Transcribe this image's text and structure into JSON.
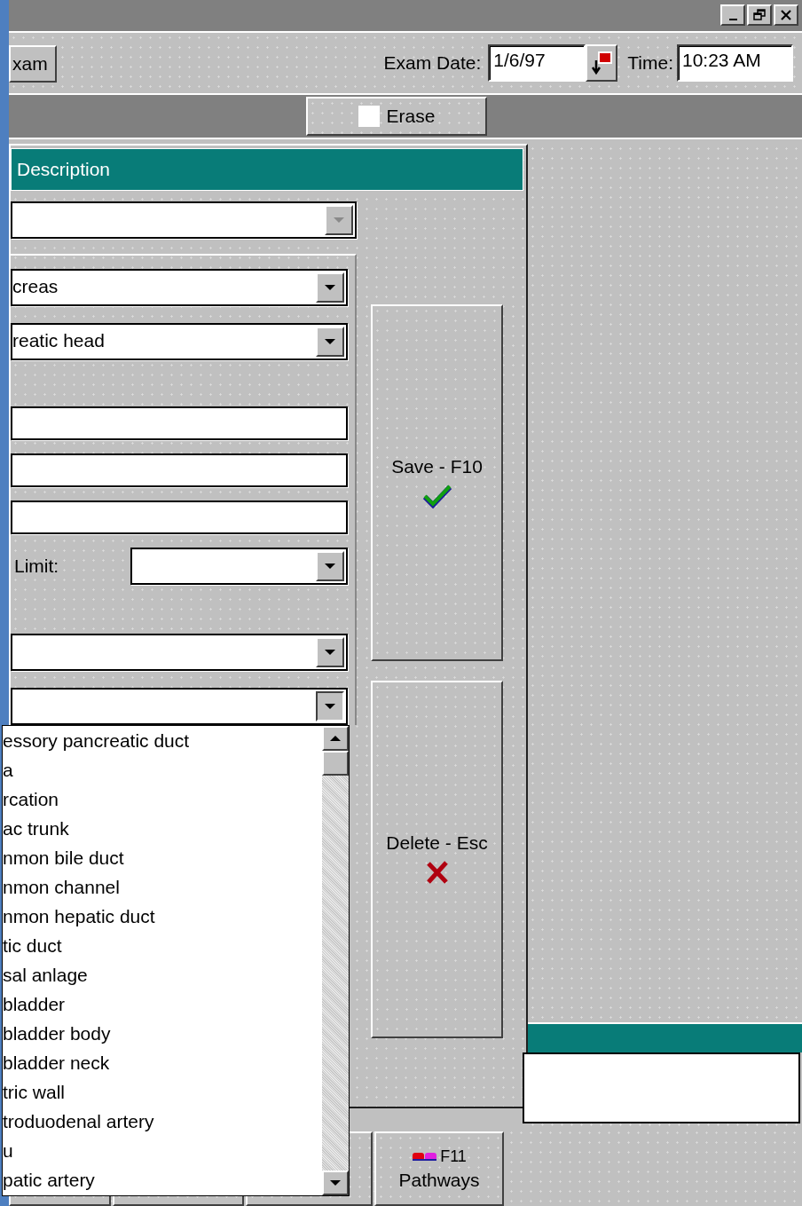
{
  "toolbar": {
    "exam_button": "xam",
    "exam_date_label": "Exam Date:",
    "exam_date": "1/6/97",
    "time_label": "Time:",
    "time": "10:23 AM"
  },
  "erase_button": {
    "label": "Erase"
  },
  "form": {
    "title": "Description",
    "top_dropdown": {
      "disabled": true
    },
    "sections": [
      [
        {
          "kind": "dropdown",
          "value": "creas",
          "disabled": false,
          "expanded": false
        },
        {
          "kind": "dropdown",
          "value": "reatic head",
          "disabled": false,
          "expanded": false
        }
      ],
      [
        {
          "kind": "text"
        },
        {
          "kind": "text"
        },
        {
          "kind": "text"
        },
        {
          "kind": "dropdown",
          "label": "Limit:",
          "disabled": false,
          "expanded": false
        }
      ],
      [
        {
          "kind": "dropdown",
          "disabled": false,
          "expanded": false
        },
        {
          "kind": "dropdown",
          "disabled": false,
          "expanded": true,
          "options": [
            "essory pancreatic duct",
            "a",
            "rcation",
            "ac trunk",
            "nmon bile duct",
            "nmon channel",
            "nmon hepatic duct",
            "tic duct",
            "sal anlage",
            "bladder",
            "bladder body",
            "bladder neck",
            "tric wall",
            "troduodenal artery",
            "u",
            "patic artery"
          ]
        }
      ]
    ],
    "actions": [
      {
        "kind": "save",
        "label": "Save - F10"
      },
      {
        "kind": "delete",
        "label": "Delete - Esc"
      }
    ]
  },
  "bottom_buttons": [
    {
      "kind": "blank"
    },
    {
      "kind": "blank"
    },
    {
      "kind": "blank"
    },
    {
      "kind": "pathways",
      "key": "F11",
      "label": "Pathways"
    }
  ]
}
